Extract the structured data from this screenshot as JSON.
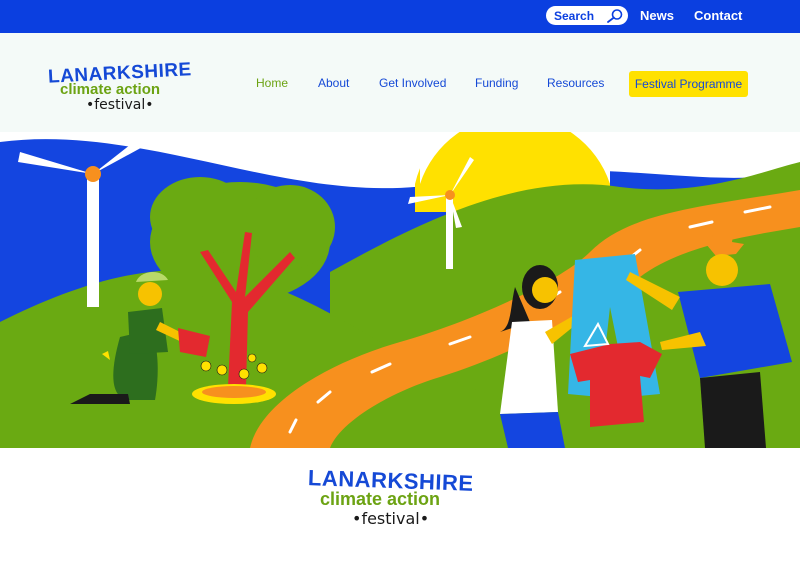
{
  "topbar": {
    "search_label": "Search",
    "links": [
      "News",
      "Contact"
    ]
  },
  "logo": {
    "line1": "LANARKSHIRE",
    "line2": "climate action",
    "line3": "•festival•"
  },
  "nav": {
    "items": [
      "Home",
      "About",
      "Get Involved",
      "Funding",
      "Resources"
    ],
    "active": "Home",
    "cta": "Festival Programme"
  },
  "hero": {
    "illustration": "climate festival scene: wind turbines, sun, gardener watering tree, clothes swap"
  },
  "colors": {
    "brand_blue": "#0b3fe0",
    "brand_green": "#6ca313",
    "cta_yellow": "#ffe100",
    "header_bg": "#f4faf8"
  },
  "icons": [
    "search-icon"
  ]
}
